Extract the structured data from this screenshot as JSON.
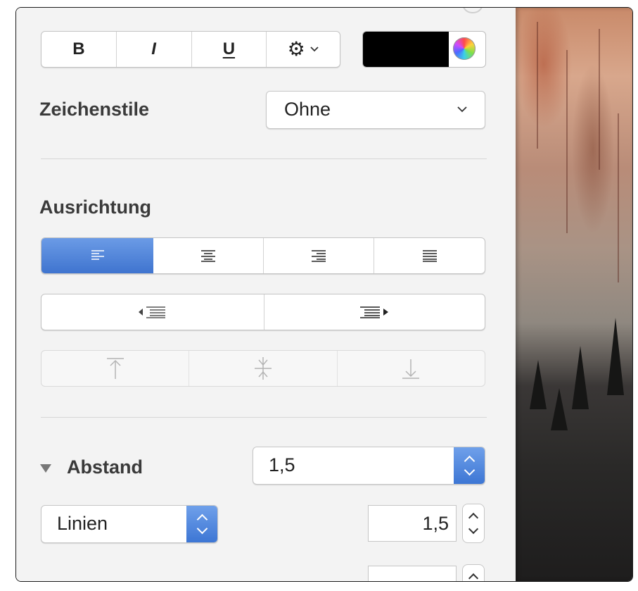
{
  "format": {
    "bold": "B",
    "italic": "I",
    "underline": "U",
    "gear": "⚙"
  },
  "colors": {
    "text_color": "#000000",
    "accent": "#4a7fd6"
  },
  "char_style": {
    "label": "Zeichenstile",
    "value": "Ohne"
  },
  "alignment": {
    "label": "Ausrichtung",
    "options": [
      "left",
      "center",
      "right",
      "justify"
    ],
    "selected": "left"
  },
  "spacing": {
    "label": "Abstand",
    "value": "1,5",
    "unit_select": "Linien",
    "line_value": "1,5"
  },
  "icons": [
    "gear-icon",
    "chevron-down-icon",
    "color-wheel-icon",
    "align-left-icon",
    "align-center-icon",
    "align-right-icon",
    "justify-icon",
    "decrease-indent-icon",
    "increase-indent-icon",
    "align-top-icon",
    "align-middle-icon",
    "align-bottom-icon",
    "disclosure-triangle-icon",
    "stepper-icon"
  ]
}
